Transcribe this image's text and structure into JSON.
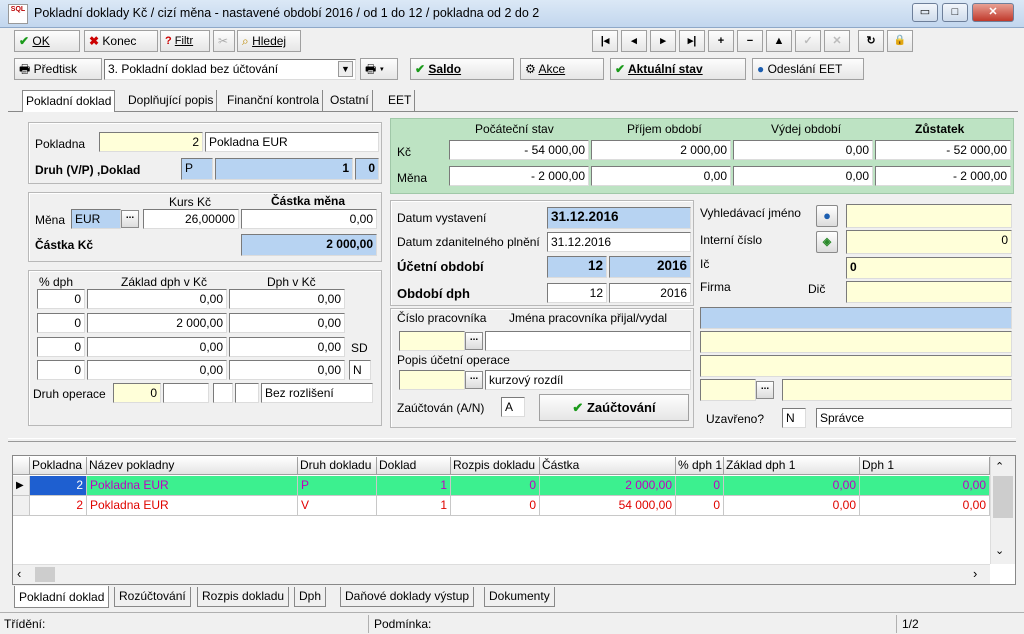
{
  "window": {
    "title": "Pokladní doklady Kč / cizí měna - nastavené období 2016 / od 1 do 12 / pokladna od 2 do 2",
    "icon_text": "SQL",
    "btn_min": "▭",
    "btn_max": "□",
    "btn_close": "✕"
  },
  "toolbar1": {
    "ok": "OK",
    "konec": "Konec",
    "filtr": "Filtr",
    "hledej": "Hledej",
    "nav": [
      "|◂",
      "◂",
      "▸",
      "▸|",
      "+",
      "−",
      "▲",
      "✓",
      "✕",
      "↻",
      "🔒"
    ]
  },
  "toolbar2": {
    "predtisk": "Předtisk",
    "doc_select": "3. Pokladní doklad bez účtování",
    "saldo": "Saldo",
    "akce": "Akce",
    "aktualni_stav": "Aktuální stav",
    "odeslani_eet": "Odeslání EET"
  },
  "tabs": [
    "Pokladní doklad",
    "Doplňující popis",
    "Finanční kontrola",
    "Ostatní",
    "EET"
  ],
  "left": {
    "pokladna_label": "Pokladna",
    "pokladna_num": "2",
    "pokladna_name": "Pokladna EUR",
    "druh_label": "Druh (V/P) ,Doklad",
    "druh_val": "P",
    "doklad_num": "1",
    "doklad_sub": "0",
    "kurs_header": "Kurs Kč",
    "castka_mena_header": "Částka měna",
    "mena_label": "Měna",
    "mena_val": "EUR",
    "kurs_val": "26,00000",
    "castka_mena_val": "0,00",
    "castka_kc_label": "Částka Kč",
    "castka_kc_val": "2 000,00",
    "dph_headers": [
      "% dph",
      "Základ dph v Kč",
      "Dph v Kč"
    ],
    "dph_rows": [
      [
        "0",
        "0,00",
        "0,00"
      ],
      [
        "0",
        "2 000,00",
        "0,00"
      ],
      [
        "0",
        "0,00",
        "0,00"
      ],
      [
        "0",
        "0,00",
        "0,00"
      ]
    ],
    "sd_label": "SD",
    "n_val": "N",
    "druh_operace_label": "Druh operace",
    "druh_operace_val": "0",
    "bez_rozliseni": "Bez rozlišení"
  },
  "summary": {
    "headers": [
      "Počáteční stav",
      "Příjem období",
      "Výdej období",
      "Zůstatek"
    ],
    "rows": [
      {
        "label": "Kč",
        "values": [
          "- 54 000,00",
          "2 000,00",
          "0,00",
          "- 52 000,00"
        ]
      },
      {
        "label": "Měna",
        "values": [
          "- 2 000,00",
          "0,00",
          "0,00",
          "- 2 000,00"
        ]
      }
    ]
  },
  "dates": {
    "datum_vystaveni_label": "Datum vystavení",
    "datum_vystaveni": "31.12.2016",
    "datum_zdan_label": "Datum zdanitelného plnění",
    "datum_zdan": "31.12.2016",
    "ucetni_obdobi_label": "Účetní období",
    "ucetni_mesic": "12",
    "ucetni_rok": "2016",
    "obdobi_dph_label": "Období dph",
    "dph_mesic": "12",
    "dph_rok": "2016"
  },
  "worker": {
    "cislo_label": "Číslo pracovníka",
    "jmena_label": "Jména pracovníka přijal/vydal",
    "popis_label": "Popis účetní operace",
    "popis_val": "kurzový rozdíl",
    "zauctovan_label": "Zaúčtován (A/N)",
    "zauctovan_val": "A",
    "zauctovani_btn": "Zaúčtování"
  },
  "partner": {
    "vyhledavaci_label": "Vyhledávací jméno",
    "interni_label": "Interní číslo",
    "interni_val": "0",
    "ic_label": "Ič",
    "ic_val": "0",
    "firma_label": "Firma",
    "dic_label": "Dič",
    "uzavreno_label": "Uzavřeno?",
    "uzavreno_val": "N",
    "spravce_val": "Správce"
  },
  "grid": {
    "headers": [
      "Pokladna",
      "Název pokladny",
      "Druh dokladu",
      "Doklad",
      "Rozpis dokladu",
      "Částka",
      "% dph 1",
      "Základ dph 1",
      "Dph 1"
    ],
    "rows": [
      [
        "2",
        "Pokladna EUR",
        "P",
        "1",
        "0",
        "2 000,00",
        "0",
        "0,00",
        "0,00"
      ],
      [
        "2",
        "Pokladna EUR",
        "V",
        "1",
        "0",
        "54 000,00",
        "0",
        "0,00",
        "0,00"
      ]
    ]
  },
  "bottom_tabs": [
    "Pokladní doklad",
    "Rozúčtování",
    "Rozpis dokladu",
    "Dph",
    "Daňové doklady výstup",
    "Dokumenty"
  ],
  "status": {
    "trideni": "Třídění:",
    "podminka": "Podmínka:",
    "page": "1/2"
  },
  "colors": {
    "summary_bg": "#bde3c3",
    "selected_row": "#3cf08f",
    "row_text_red": "#e00000",
    "row_text_purple": "#c000c0"
  }
}
